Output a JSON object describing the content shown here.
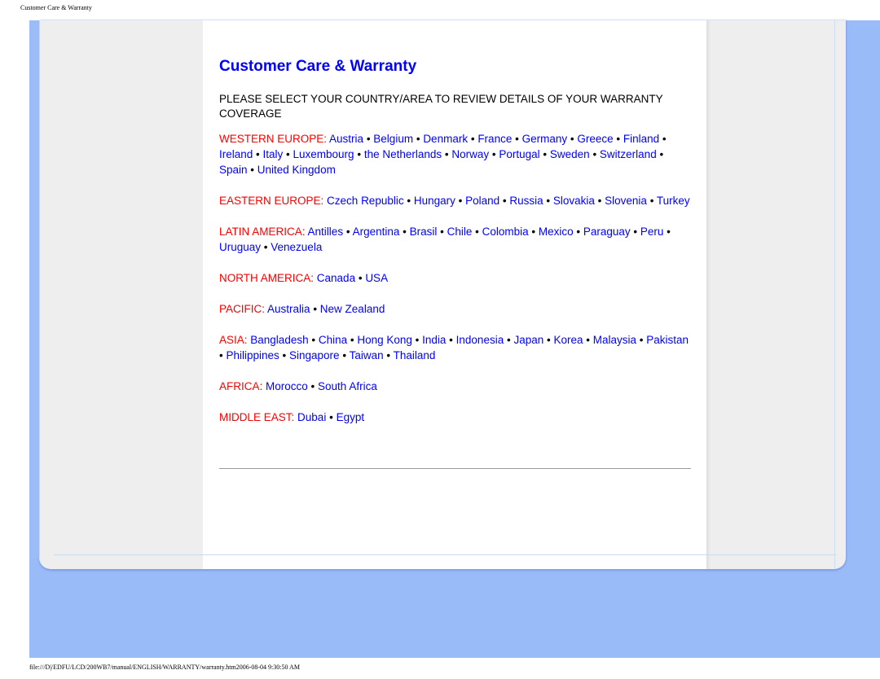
{
  "print_header": "Customer Care & Warranty",
  "print_footer": "file:///D|/EDFU/LCD/200WB7/manual/ENGLISH/WARRANTY/warranty.htm2006-08-04 9:30:50 AM",
  "page": {
    "title": "Customer Care & Warranty",
    "intro": "PLEASE SELECT YOUR COUNTRY/AREA TO REVIEW DETAILS OF YOUR WARRANTY COVERAGE",
    "separator": " • ",
    "regions": [
      {
        "name": "WESTERN EUROPE:",
        "countries": [
          "Austria",
          "Belgium",
          "Denmark",
          "France",
          "Germany",
          "Greece",
          "Finland",
          "Ireland",
          "Italy",
          "Luxembourg",
          "the Netherlands",
          "Norway",
          "Portugal",
          "Sweden",
          "Switzerland",
          "Spain",
          "United Kingdom"
        ]
      },
      {
        "name": "EASTERN EUROPE:",
        "countries": [
          "Czech Republic",
          "Hungary",
          "Poland",
          "Russia",
          "Slovakia",
          "Slovenia",
          "Turkey"
        ]
      },
      {
        "name": "LATIN AMERICA:",
        "countries": [
          "Antilles",
          "Argentina",
          "Brasil",
          "Chile",
          "Colombia",
          "Mexico",
          "Paraguay",
          "Peru",
          "Uruguay",
          "Venezuela"
        ]
      },
      {
        "name": "NORTH AMERICA:",
        "countries": [
          "Canada",
          "USA"
        ]
      },
      {
        "name": "PACIFIC:",
        "countries": [
          "Australia",
          "New Zealand"
        ]
      },
      {
        "name": "ASIA:",
        "countries": [
          "Bangladesh",
          "China",
          "Hong Kong",
          "India",
          "Indonesia",
          "Japan",
          "Korea",
          "Malaysia",
          "Pakistan",
          "Philippines",
          "Singapore",
          "Taiwan",
          "Thailand"
        ]
      },
      {
        "name": "AFRICA:",
        "countries": [
          "Morocco",
          "South Africa"
        ]
      },
      {
        "name": "MIDDLE EAST:",
        "countries": [
          "Dubai",
          "Egypt"
        ]
      }
    ]
  },
  "colors": {
    "title": "#0000ff",
    "region": "#ff0000",
    "link": "#0000ff",
    "frame": "#99bbf8"
  }
}
